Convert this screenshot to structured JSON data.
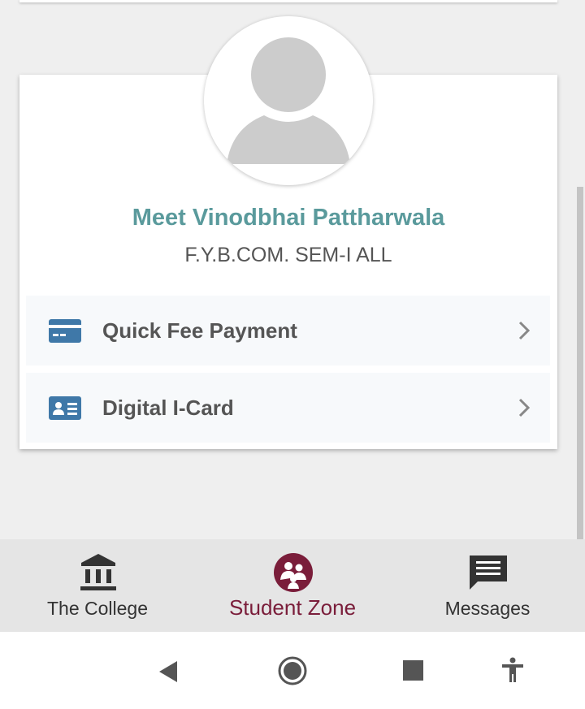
{
  "profile": {
    "name": "Meet Vinodbhai Pattharwala",
    "class": "F.Y.B.COM. SEM-I ALL"
  },
  "menu": [
    {
      "label": "Quick Fee Payment",
      "icon": "credit-card-icon"
    },
    {
      "label": "Digital I-Card",
      "icon": "id-card-icon"
    }
  ],
  "bottom_nav": [
    {
      "label": "The College",
      "icon": "college-building-icon",
      "active": false
    },
    {
      "label": "Student Zone",
      "icon": "student-group-icon",
      "active": true
    },
    {
      "label": "Messages",
      "icon": "message-icon",
      "active": false
    }
  ],
  "system_nav": [
    "back-icon",
    "home-icon",
    "recents-icon",
    "accessibility-icon"
  ],
  "colors": {
    "name": "#5a9a9c",
    "accent": "#7a1d3a",
    "icon_blue": "#3f78a8"
  }
}
